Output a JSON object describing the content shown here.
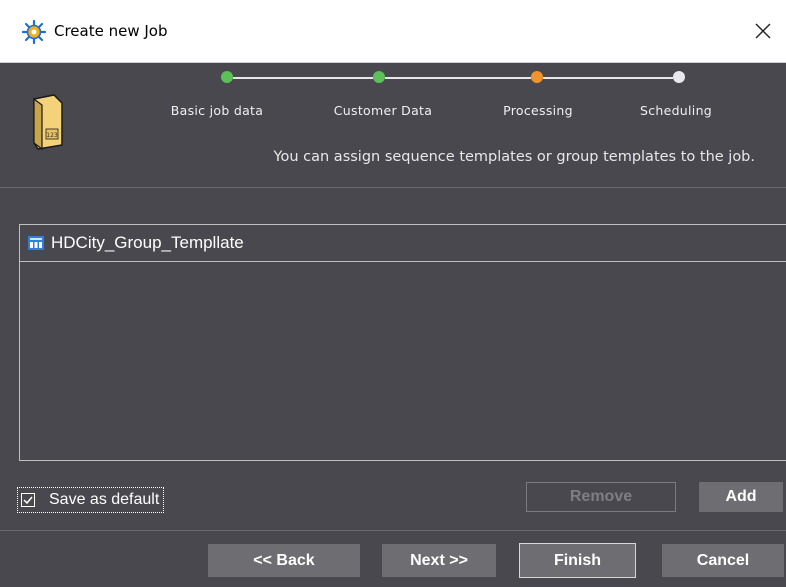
{
  "window": {
    "title": "Create new Job"
  },
  "wizard": {
    "steps": [
      {
        "label": "Basic job data",
        "state": "done",
        "color": "#5cbf5a"
      },
      {
        "label": "Customer Data",
        "state": "done",
        "color": "#5cbf5a"
      },
      {
        "label": "Processing",
        "state": "current",
        "color": "#f0932b"
      },
      {
        "label": "Scheduling",
        "state": "pending",
        "color": "#e8e8ee"
      }
    ],
    "info_text": "You can assign sequence templates or group templates to the job."
  },
  "templates": {
    "items": [
      {
        "label": "HDCity_Group_Templlate",
        "icon": "group-template-icon"
      }
    ]
  },
  "options": {
    "save_default_label": "Save as default",
    "save_default_checked": true
  },
  "buttons": {
    "remove": "Remove",
    "add": "Add",
    "back": "<< Back",
    "next": "Next >>",
    "finish": "Finish",
    "cancel": "Cancel"
  },
  "colors": {
    "background": "#48484e",
    "button": "#6e6e72",
    "done": "#5cbf5a",
    "current": "#f0932b"
  }
}
